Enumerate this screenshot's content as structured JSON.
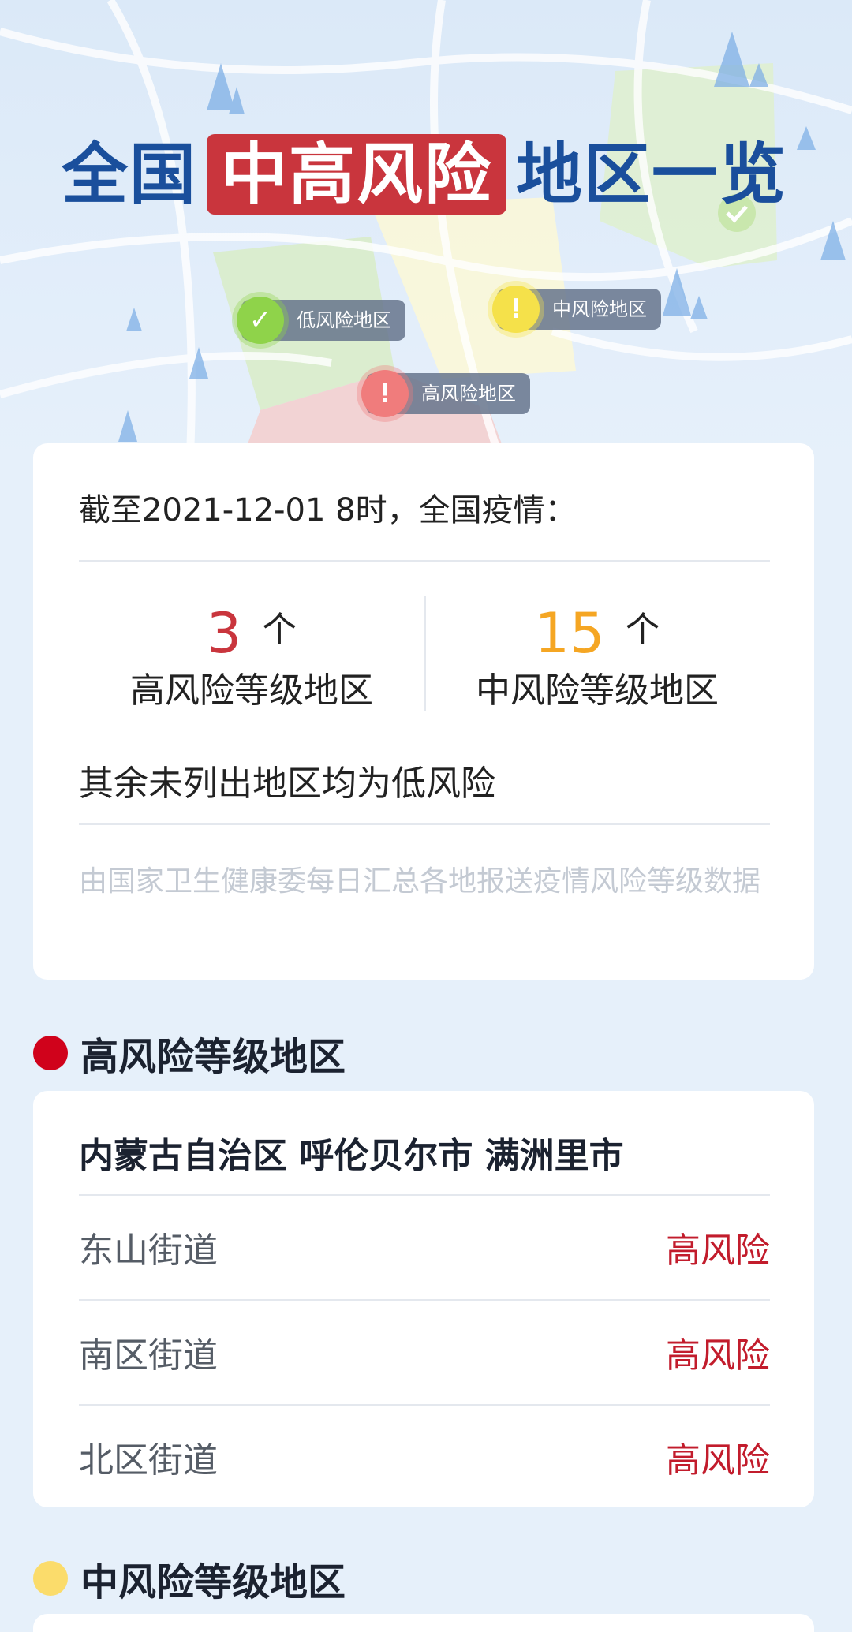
{
  "header": {
    "title_pre": "全国",
    "title_highlight": "中高风险",
    "title_post": "地区一览",
    "legend": {
      "low": "低风险地区",
      "mid": "中风险地区",
      "high": "高风险地区"
    }
  },
  "summary": {
    "as_of": "截至2021-12-01 8时，全国疫情：",
    "high": {
      "count": "3",
      "unit": "个",
      "label": "高风险等级地区",
      "color": "#c9353d"
    },
    "mid": {
      "count": "15",
      "unit": "个",
      "label": "中风险等级地区",
      "color": "#f5a623"
    },
    "rest_note": "其余未列出地区均为低风险",
    "source_note": "由国家卫生健康委每日汇总各地报送疫情风险等级数据"
  },
  "high_section": {
    "title": "高风险等级地区",
    "bullet_color": "#d0021b",
    "areas": [
      {
        "name": "内蒙古自治区 呼伦贝尔市 满洲里市",
        "streets": [
          {
            "name": "东山街道",
            "level": "高风险"
          },
          {
            "name": "南区街道",
            "level": "高风险"
          },
          {
            "name": "北区街道",
            "level": "高风险"
          }
        ]
      }
    ]
  },
  "mid_section": {
    "title": "中风险等级地区",
    "bullet_color": "#fbdc6b"
  }
}
